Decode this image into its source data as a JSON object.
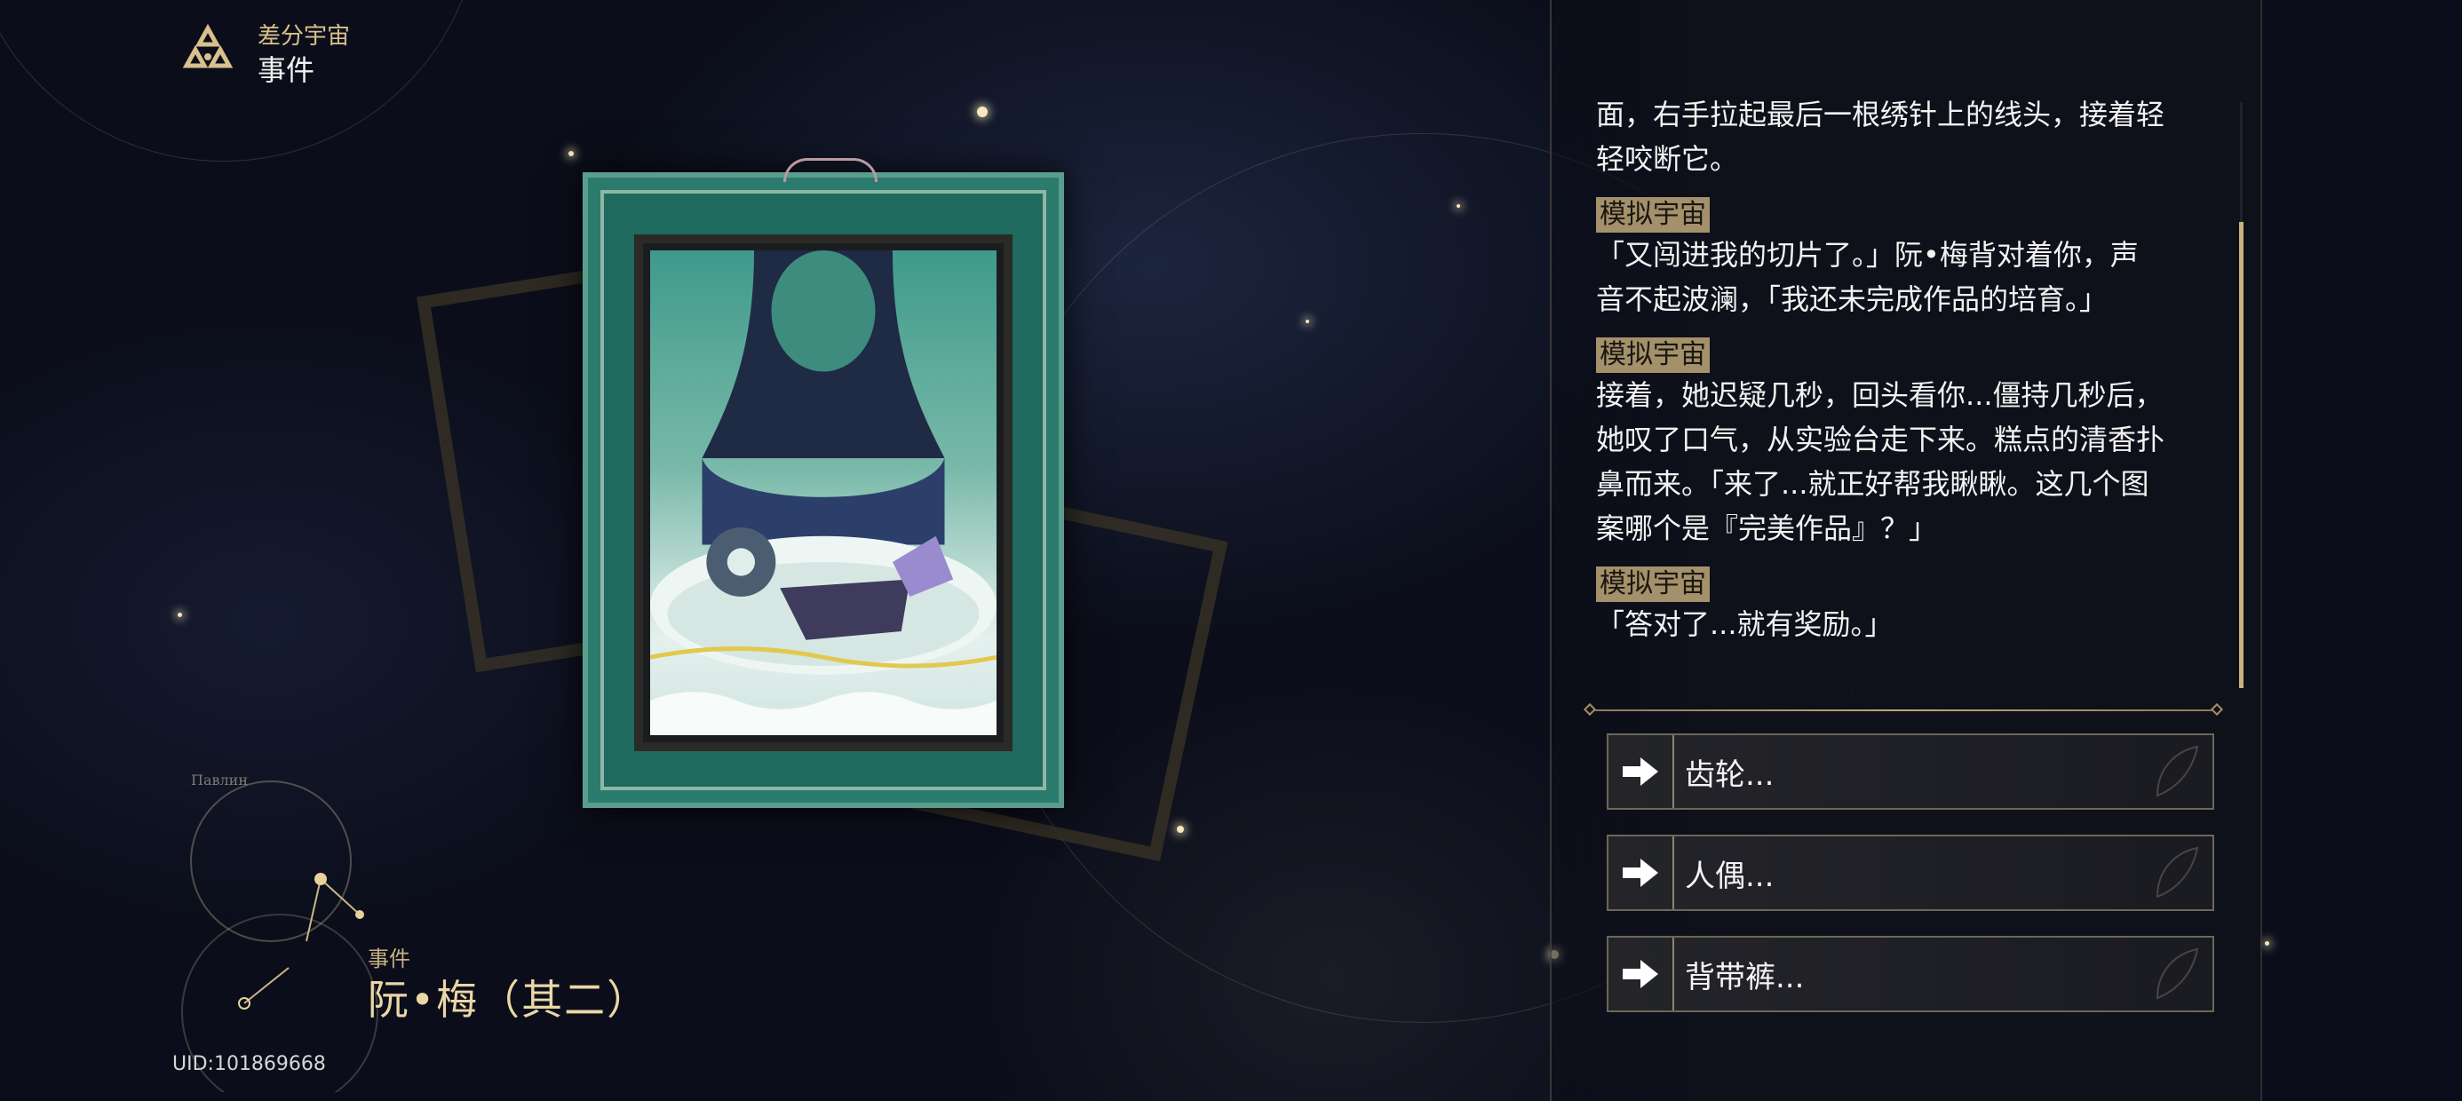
{
  "header": {
    "mode_label": "差分宇宙",
    "section_title": "事件"
  },
  "event": {
    "kicker": "事件",
    "title": "阮•梅（其二）",
    "uid": "UID:101869668",
    "constellation_label": "Павлин"
  },
  "dialog": {
    "entries": [
      {
        "speaker": "",
        "lines": [
          "面，右手拉起最后一根绣针上的线头，接着轻",
          "轻咬断它。"
        ]
      },
      {
        "speaker": "模拟宇宙",
        "lines": [
          "「又闯进我的切片了。」阮•梅背对着你，声",
          "音不起波澜，「我还未完成作品的培育。」"
        ]
      },
      {
        "speaker": "模拟宇宙",
        "lines": [
          "接着，她迟疑几秒，回头看你...僵持几秒后，",
          "她叹了口气，从实验台走下来。糕点的清香扑",
          "鼻而来。「来了...就正好帮我瞅瞅。这几个图",
          "案哪个是『完美作品』？」"
        ]
      },
      {
        "speaker": "模拟宇宙",
        "lines": [
          "「答对了...就有奖励。」"
        ]
      }
    ]
  },
  "options": [
    {
      "label": "齿轮..."
    },
    {
      "label": "人偶..."
    },
    {
      "label": "背带裤..."
    }
  ],
  "colors": {
    "accent_gold": "#d9c08c",
    "speaker_tag": "#a4906a",
    "frame_teal": "#1f6a5e"
  }
}
